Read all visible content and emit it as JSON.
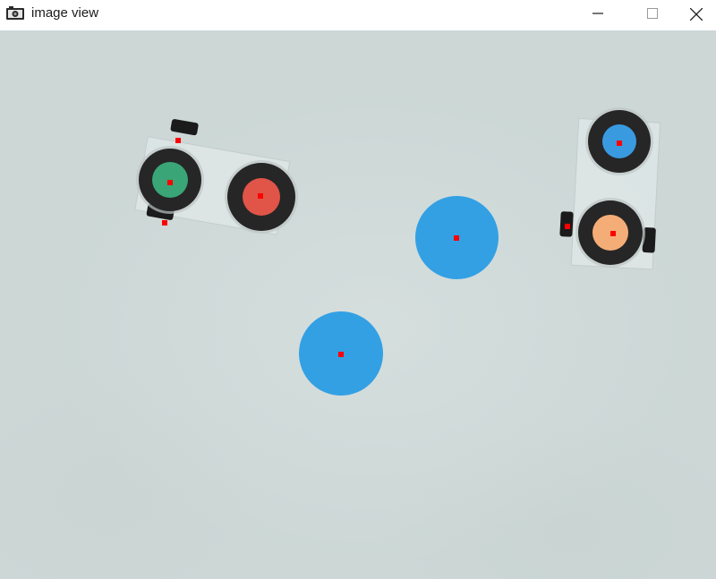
{
  "window": {
    "title": "image view",
    "icon": "camera-icon",
    "controls": [
      "minimize-icon",
      "maximize-icon",
      "close-icon"
    ]
  },
  "scene": {
    "background_color": "#ccd7d6",
    "marker_color": "#ff0000",
    "balls": [
      {
        "name": "ball-1",
        "color": "#33a0e4"
      },
      {
        "name": "ball-2",
        "color": "#33a0e4"
      }
    ],
    "robots": [
      {
        "name": "robot-left",
        "front_cap_color": "#e05548",
        "rear_cap_color": "#3aa577"
      },
      {
        "name": "robot-right",
        "front_cap_color": "#3a9ae0",
        "rear_cap_color": "#f5ad78"
      }
    ]
  }
}
